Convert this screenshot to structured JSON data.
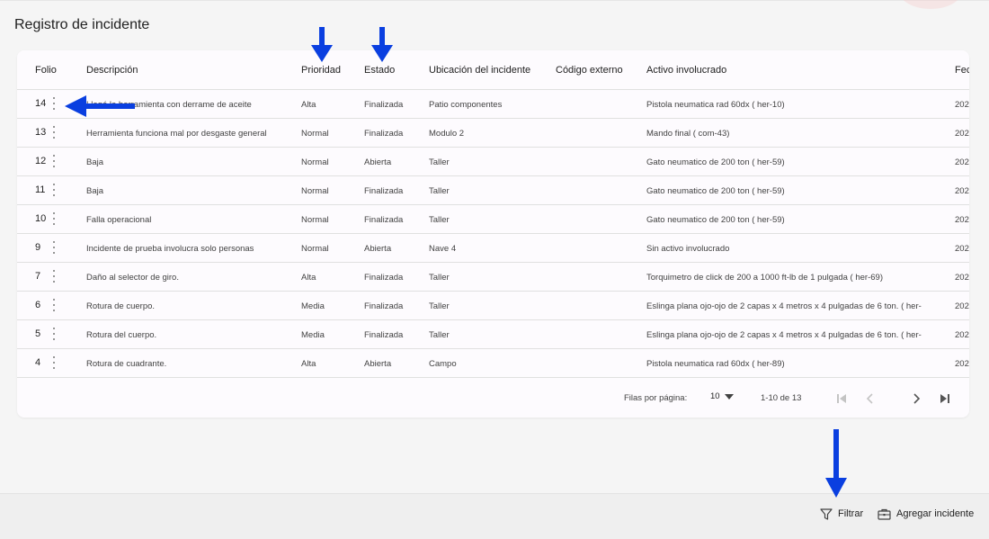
{
  "page": {
    "title": "Registro de incidente"
  },
  "table": {
    "headers": {
      "folio": "Folio",
      "descripcion": "Descripción",
      "prioridad": "Prioridad",
      "estado": "Estado",
      "ubicacion": "Ubicación del incidente",
      "codigo": "Código externo",
      "activo": "Activo involucrado",
      "fecha": "Fec"
    },
    "rows": [
      {
        "folio": "14",
        "descripcion": "Llegó la herramienta con derrame de aceite",
        "prioridad": "Alta",
        "estado": "Finalizada",
        "ubicacion": "Patio componentes",
        "codigo": "",
        "activo": "Pistola neumatica rad 60dx ( her-10)",
        "fecha": "202"
      },
      {
        "folio": "13",
        "descripcion": "Herramienta funciona mal por desgaste general",
        "prioridad": "Normal",
        "estado": "Finalizada",
        "ubicacion": "Modulo 2",
        "codigo": "",
        "activo": "Mando final ( com-43)",
        "fecha": "202"
      },
      {
        "folio": "12",
        "descripcion": "Baja",
        "prioridad": "Normal",
        "estado": "Abierta",
        "ubicacion": "Taller",
        "codigo": "",
        "activo": "Gato neumatico de 200 ton ( her-59)",
        "fecha": "202"
      },
      {
        "folio": "11",
        "descripcion": "Baja",
        "prioridad": "Normal",
        "estado": "Finalizada",
        "ubicacion": "Taller",
        "codigo": "",
        "activo": "Gato neumatico de 200 ton ( her-59)",
        "fecha": "202"
      },
      {
        "folio": "10",
        "descripcion": "Falla operacional",
        "prioridad": "Normal",
        "estado": "Finalizada",
        "ubicacion": "Taller",
        "codigo": "",
        "activo": "Gato neumatico de 200 ton ( her-59)",
        "fecha": "202"
      },
      {
        "folio": "9",
        "descripcion": "Incidente de prueba involucra solo personas",
        "prioridad": "Normal",
        "estado": "Abierta",
        "ubicacion": "Nave 4",
        "codigo": "",
        "activo": "Sin activo involucrado",
        "fecha": "202"
      },
      {
        "folio": "7",
        "descripcion": "Daño al selector de giro.",
        "prioridad": "Alta",
        "estado": "Finalizada",
        "ubicacion": "Taller",
        "codigo": "",
        "activo": "Torquimetro de click de 200 a 1000 ft-lb de 1 pulgada ( her-69)",
        "fecha": "202"
      },
      {
        "folio": "6",
        "descripcion": "Rotura de cuerpo.",
        "prioridad": "Media",
        "estado": "Finalizada",
        "ubicacion": "Taller",
        "codigo": "",
        "activo": "Eslinga plana ojo-ojo de 2 capas x 4 metros x 4 pulgadas de 6 ton. ( her-",
        "fecha": "202"
      },
      {
        "folio": "5",
        "descripcion": "Rotura del cuerpo.",
        "prioridad": "Media",
        "estado": "Finalizada",
        "ubicacion": "Taller",
        "codigo": "",
        "activo": "Eslinga plana ojo-ojo de 2 capas x 4 metros x 4 pulgadas de 6 ton. ( her-",
        "fecha": "202"
      },
      {
        "folio": "4",
        "descripcion": "Rotura de cuadrante.",
        "prioridad": "Alta",
        "estado": "Abierta",
        "ubicacion": "Campo",
        "codigo": "",
        "activo": "Pistola neumatica rad 60dx ( her-89)",
        "fecha": "202"
      }
    ]
  },
  "pagination": {
    "rows_per_page_label": "Filas por página:",
    "rows_per_page_value": "10",
    "range": "1-10 de 13"
  },
  "actions": {
    "filter_label": "Filtrar",
    "add_label": "Agregar incidente"
  },
  "colors": {
    "annotation_arrow": "#0a3fe0"
  }
}
